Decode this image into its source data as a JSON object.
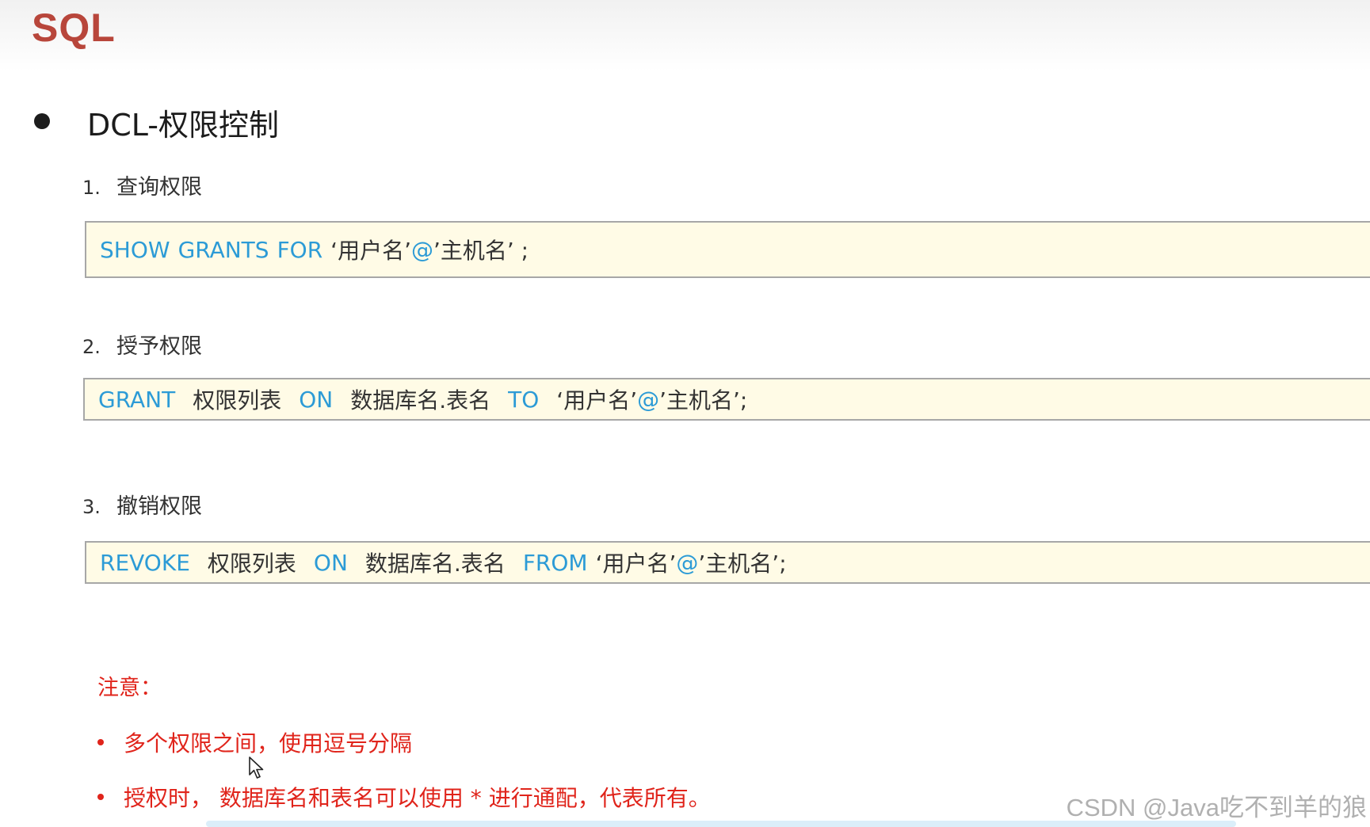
{
  "header": {
    "title": "SQL"
  },
  "section": {
    "heading": "DCL-权限控制"
  },
  "steps": [
    {
      "number": "1.",
      "label": "查询权限",
      "code": {
        "kw1": "SHOW",
        "kw2": "GRANTS",
        "kw3": "FOR",
        "target_user": "‘用户名’",
        "at": "@",
        "target_host": "’主机名’ ;"
      }
    },
    {
      "number": "2.",
      "label": "授予权限",
      "code": {
        "kw1": "GRANT",
        "privs": "权限列表",
        "kw2": "ON",
        "object": "数据库名.表名",
        "kw3": "TO",
        "target_user": "‘用户名’",
        "at": "@",
        "target_host": "’主机名’;"
      }
    },
    {
      "number": "3.",
      "label": "撤销权限",
      "code": {
        "kw1": "REVOKE",
        "privs": "权限列表",
        "kw2": "ON",
        "object": "数据库名.表名",
        "kw3": "FROM",
        "target_user": "‘用户名’",
        "at": "@",
        "target_host": "’主机名’;"
      }
    }
  ],
  "note": {
    "title": "注意：",
    "items": [
      "多个权限之间，使用逗号分隔",
      "授权时， 数据库名和表名可以使用 * 进行通配，代表所有。"
    ]
  },
  "watermark": "CSDN @Java吃不到羊的狼",
  "colors": {
    "title": "#b8463b",
    "keyword": "#2c9bd6",
    "note": "#e0241b",
    "code_background": "#fffbe6"
  }
}
